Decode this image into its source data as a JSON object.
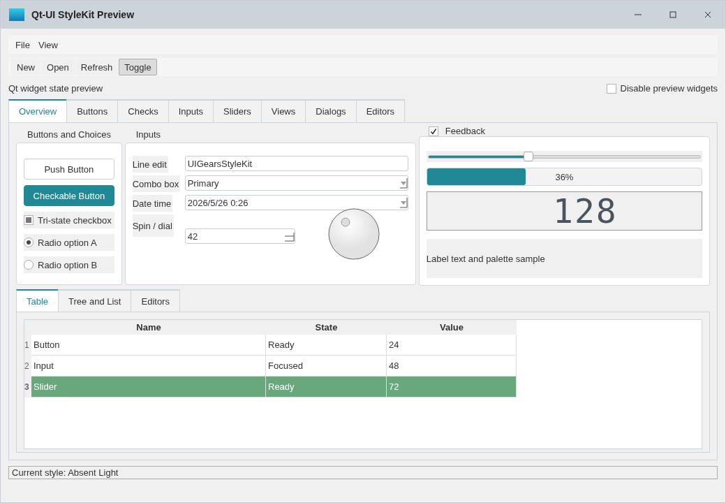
{
  "window": {
    "title": "Qt-UI StyleKit Preview"
  },
  "menu": [
    "File",
    "View"
  ],
  "toolbar": [
    {
      "label": "New",
      "checked": false
    },
    {
      "label": "Open",
      "checked": false
    },
    {
      "label": "Refresh",
      "checked": false
    },
    {
      "label": "Toggle",
      "checked": true
    }
  ],
  "caption": "Qt widget state preview",
  "disable_toggle": {
    "label": "Disable preview widgets",
    "checked": false
  },
  "tabs": [
    {
      "label": "Overview",
      "selected": true
    },
    {
      "label": "Buttons",
      "selected": false
    },
    {
      "label": "Checks",
      "selected": false
    },
    {
      "label": "Inputs",
      "selected": false
    },
    {
      "label": "Sliders",
      "selected": false
    },
    {
      "label": "Views",
      "selected": false
    },
    {
      "label": "Dialogs",
      "selected": false
    },
    {
      "label": "Editors",
      "selected": false
    }
  ],
  "buttons_group": {
    "title": "Buttons and Choices",
    "push_button": "Push Button",
    "checkable_button": {
      "label": "Checkable Button",
      "checked": true
    },
    "tristate": {
      "label": "Tri-state checkbox",
      "partial": true
    },
    "radios": [
      {
        "label": "Radio option A",
        "selected": true
      },
      {
        "label": "Radio option B",
        "selected": false
      }
    ]
  },
  "inputs_group": {
    "title": "Inputs",
    "line_edit": {
      "label": "Line edit",
      "value": "UIGearsStyleKit"
    },
    "combo": {
      "label": "Combo box",
      "value": "Primary"
    },
    "datetime": {
      "label": "Date time",
      "value": "2026/5/26 0:26"
    },
    "spin": {
      "label": "Spin / dial",
      "value": "42"
    }
  },
  "feedback_group": {
    "title": "Feedback",
    "checked": true,
    "slider": {
      "level": 0.37
    },
    "progress": {
      "level": 0.36,
      "text": "36%"
    },
    "lcd": "128",
    "label": "Label text and palette sample"
  },
  "inner_tabs": [
    {
      "label": "Table",
      "selected": true
    },
    {
      "label": "Tree and List",
      "selected": false
    },
    {
      "label": "Editors",
      "selected": false
    }
  ],
  "table": {
    "columns": [
      "Name",
      "State",
      "Value"
    ],
    "rows": [
      {
        "header": "1",
        "cells": [
          "Button",
          "Ready",
          "24"
        ],
        "selected": false
      },
      {
        "header": "2",
        "cells": [
          "Input",
          "Focused",
          "48"
        ],
        "selected": false
      },
      {
        "header": "3",
        "cells": [
          "Slider",
          "Ready",
          "72"
        ],
        "selected": true
      }
    ]
  },
  "status_bar": "Current style: Absent Light"
}
